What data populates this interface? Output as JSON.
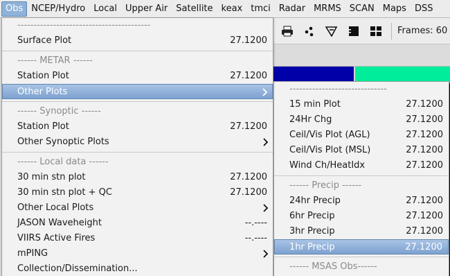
{
  "menubar": {
    "items": [
      "Obs",
      "NCEP/Hydro",
      "Local",
      "Upper Air",
      "Satellite",
      "keax",
      "tmci",
      "Radar",
      "MRMS",
      "SCAN",
      "Maps",
      "DSS"
    ]
  },
  "toolbar": {
    "icons": [
      "printer-icon",
      "dots-icon",
      "pointer-icon",
      "single-panel-icon",
      "four-panel-icon"
    ],
    "frames_label": "Frames: 60"
  },
  "obs_menu": {
    "items": [
      {
        "kind": "header",
        "label": "-----------------------------------------"
      },
      {
        "kind": "item",
        "label": "Surface Plot",
        "version": "27.1200"
      },
      {
        "kind": "sep"
      },
      {
        "kind": "header",
        "label": "------ METAR ------"
      },
      {
        "kind": "item",
        "label": "Station Plot",
        "version": "27.1200"
      },
      {
        "kind": "submenu",
        "label": "Other Plots",
        "highlighted": true
      },
      {
        "kind": "sep"
      },
      {
        "kind": "header",
        "label": "------ Synoptic ------"
      },
      {
        "kind": "item",
        "label": "Station Plot",
        "version": "27.1200"
      },
      {
        "kind": "submenu",
        "label": "Other Synoptic Plots"
      },
      {
        "kind": "sep"
      },
      {
        "kind": "header",
        "label": "------ Local data ------"
      },
      {
        "kind": "item",
        "label": "30 min stn plot",
        "version": "27.1200"
      },
      {
        "kind": "item",
        "label": "30 min stn plot + QC",
        "version": "27.1200"
      },
      {
        "kind": "submenu",
        "label": "Other Local Plots"
      },
      {
        "kind": "item",
        "label": "JASON Waveheight",
        "version": "--.----"
      },
      {
        "kind": "item",
        "label": "VIIRS Active Fires",
        "version": "--.----"
      },
      {
        "kind": "submenu",
        "label": "mPING"
      },
      {
        "kind": "item",
        "label": "Collection/Dissemination...",
        "version": ""
      }
    ]
  },
  "sub_menu": {
    "items": [
      {
        "kind": "header",
        "label": "------------------------------"
      },
      {
        "kind": "item",
        "label": "15 min Plot",
        "version": "27.1200"
      },
      {
        "kind": "item",
        "label": "24Hr Chg",
        "version": "27.1200"
      },
      {
        "kind": "item",
        "label": "Ceil/Vis Plot (AGL)",
        "version": "27.1200"
      },
      {
        "kind": "item",
        "label": "Ceil/Vis Plot (MSL)",
        "version": "27.1200"
      },
      {
        "kind": "item",
        "label": "Wind Ch/HeatIdx",
        "version": "27.1200"
      },
      {
        "kind": "sep"
      },
      {
        "kind": "header",
        "label": "------ Precip ------"
      },
      {
        "kind": "item",
        "label": "24hr Precip",
        "version": "27.1200"
      },
      {
        "kind": "item",
        "label": "6hr Precip",
        "version": "27.1200"
      },
      {
        "kind": "item",
        "label": "3hr Precip",
        "version": "27.1200"
      },
      {
        "kind": "item",
        "label": "1hr Precip",
        "version": "27.1200",
        "highlighted": true
      },
      {
        "kind": "sep"
      },
      {
        "kind": "header",
        "label": "------ MSAS Obs------"
      }
    ]
  },
  "colors": {
    "highlight": "#7ea1cf",
    "blue_bar": "#0000a8",
    "green_bar": "#00ee9b"
  }
}
